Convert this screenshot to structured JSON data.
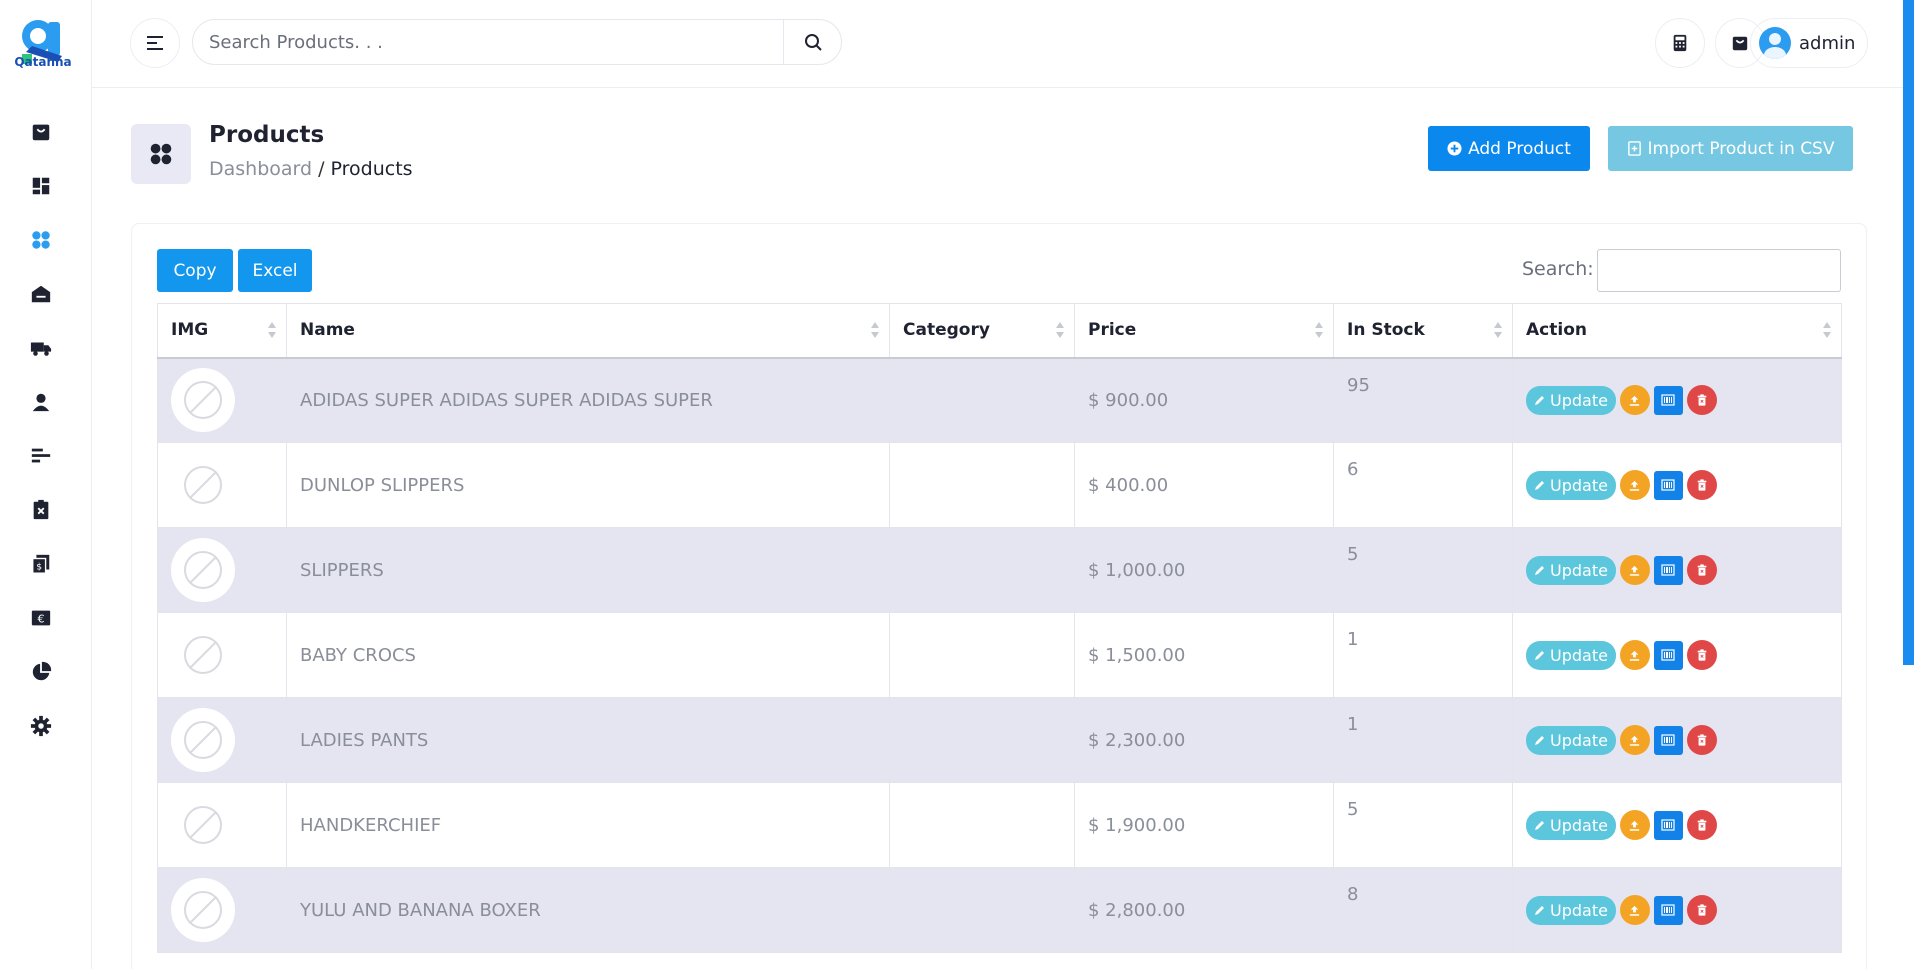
{
  "brand": {
    "logo_text": "Qatanna"
  },
  "topbar": {
    "search_placeholder": "Search Products. . .",
    "user_name": "admin"
  },
  "page": {
    "title": "Products",
    "breadcrumb_root": "Dashboard",
    "breadcrumb_separator": "/",
    "breadcrumb_current": "Products",
    "add_button": "Add Product",
    "import_button": "Import Product in CSV"
  },
  "table_tools": {
    "copy_label": "Copy",
    "excel_label": "Excel",
    "search_label": "Search:"
  },
  "table": {
    "headers": [
      "IMG",
      "Name",
      "Category",
      "Price",
      "In Stock",
      "Action"
    ],
    "update_label": "Update",
    "rows": [
      {
        "name": "ADIDAS SUPER ADIDAS SUPER ADIDAS SUPER",
        "category": "",
        "price": "$ 900.00",
        "stock": "95"
      },
      {
        "name": "DUNLOP SLIPPERS",
        "category": "",
        "price": "$ 400.00",
        "stock": "6"
      },
      {
        "name": "SLIPPERS",
        "category": "",
        "price": "$ 1,000.00",
        "stock": "5"
      },
      {
        "name": "BABY CROCS",
        "category": "",
        "price": "$ 1,500.00",
        "stock": "1"
      },
      {
        "name": "LADIES PANTS",
        "category": "",
        "price": "$ 2,300.00",
        "stock": "1"
      },
      {
        "name": "HANDKERCHIEF",
        "category": "",
        "price": "$ 1,900.00",
        "stock": "5"
      },
      {
        "name": "YULU AND BANANA BOXER",
        "category": "",
        "price": "$ 2,800.00",
        "stock": "8"
      }
    ]
  },
  "sidebar_icons": [
    "shopping-bag-icon",
    "dashboard-icon",
    "products-icon",
    "warehouse-icon",
    "truck-icon",
    "user-icon",
    "report-icon",
    "expense-icon",
    "invoice-icon",
    "euro-icon",
    "pie-chart-icon",
    "gear-icon"
  ],
  "colors": {
    "primary": "#0a88ee",
    "info": "#5bc6dc",
    "warning": "#f4a424",
    "danger": "#e04848",
    "row_stripe": "#e4e5f1"
  }
}
